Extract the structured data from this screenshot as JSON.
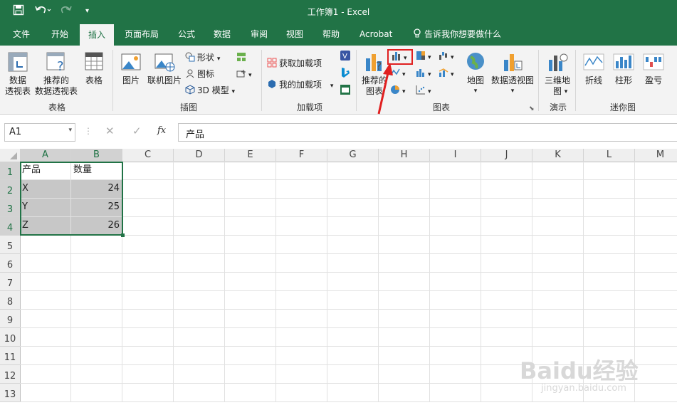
{
  "window": {
    "title": "工作簿1  -  Excel"
  },
  "tabs": [
    "文件",
    "开始",
    "插入",
    "页面布局",
    "公式",
    "数据",
    "审阅",
    "视图",
    "帮助",
    "Acrobat"
  ],
  "active_tab": "插入",
  "tell_me": "告诉我你想要做什么",
  "ribbon": {
    "tables": {
      "pivot": "数据\n透视表",
      "recommended_pivot": "推荐的\n数据透视表",
      "table": "表格",
      "group": "表格"
    },
    "illustrations": {
      "pictures": "图片",
      "online_pictures": "联机图片",
      "shapes": "形状",
      "icons": "图标",
      "models3d": "3D 模型",
      "group": "插图"
    },
    "addins": {
      "get": "获取加载项",
      "my": "我的加载项",
      "group": "加载项"
    },
    "charts": {
      "recommended": "推荐的\n图表",
      "maps": "地图",
      "pivotchart": "数据透视图",
      "group": "图表"
    },
    "tours": {
      "map3d": "三维地\n图",
      "group": "演示"
    },
    "sparklines": {
      "line": "折线",
      "column": "柱形",
      "winloss": "盈亏",
      "group": "迷你图"
    }
  },
  "formula_bar": {
    "name_box": "A1",
    "fx": "fx",
    "content": "产品"
  },
  "columns": [
    "A",
    "B",
    "C",
    "D",
    "E",
    "F",
    "G",
    "H",
    "I",
    "J",
    "K",
    "L",
    "M"
  ],
  "rows": [
    "1",
    "2",
    "3",
    "4",
    "5",
    "6",
    "7",
    "8",
    "9",
    "10",
    "11",
    "12",
    "13"
  ],
  "cells": {
    "A1": "产品",
    "B1": "数量",
    "A2": "X",
    "B2": "24",
    "A3": "Y",
    "B3": "25",
    "A4": "Z",
    "B4": "26"
  },
  "watermark": {
    "brand": "Baidu经验",
    "url": "jingyan.baidu.com"
  },
  "colors": {
    "excel_green": "#217346",
    "highlight_red": "#e02020"
  }
}
